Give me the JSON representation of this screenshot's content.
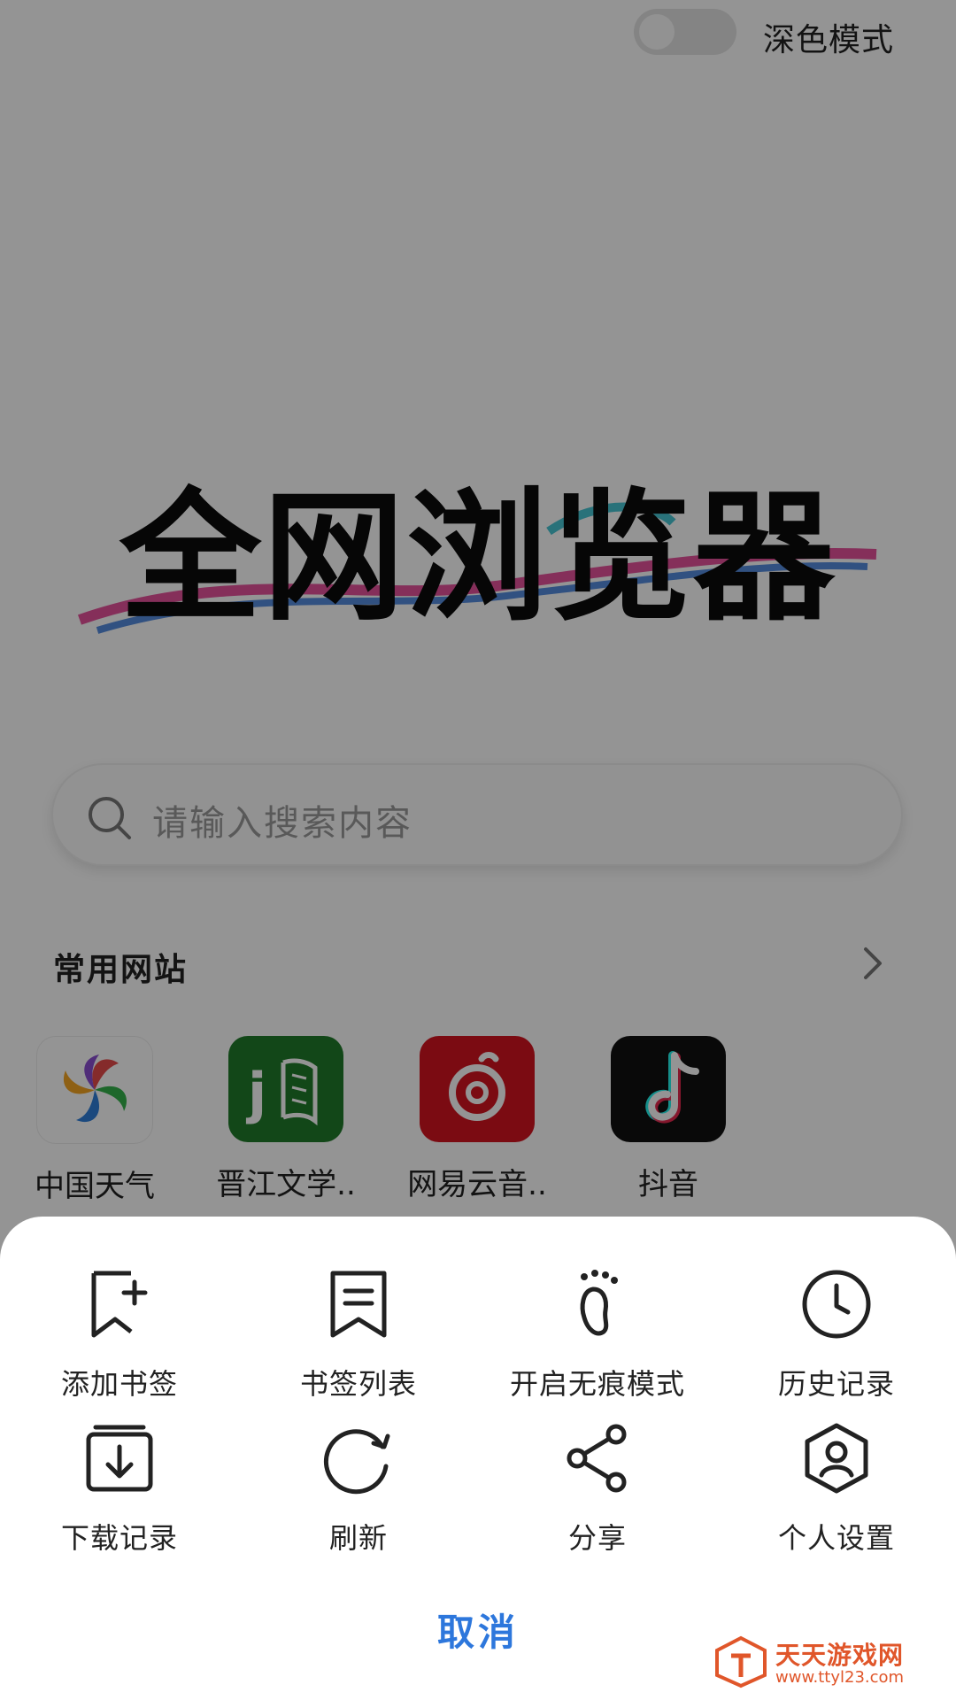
{
  "header": {
    "dark_mode_label": "深色模式",
    "dark_mode_on": false
  },
  "logo": {
    "text": "全网浏览器"
  },
  "search": {
    "placeholder": "请输入搜索内容"
  },
  "sites": {
    "title": "常用网站",
    "items": [
      {
        "label": "中国天气",
        "icon": "china-weather-icon",
        "color": "#ffffff"
      },
      {
        "label": "晋江文学..",
        "icon": "jinjiang-literature-icon",
        "color": "#1f7a2a"
      },
      {
        "label": "网易云音..",
        "icon": "netease-music-icon",
        "color": "#d5131f"
      },
      {
        "label": "抖音",
        "icon": "douyin-icon",
        "color": "#111111"
      }
    ]
  },
  "menu": {
    "items": [
      {
        "label": "添加书签",
        "icon": "add-bookmark-icon"
      },
      {
        "label": "书签列表",
        "icon": "bookmark-list-icon"
      },
      {
        "label": "开启无痕模式",
        "icon": "footprint-icon"
      },
      {
        "label": "历史记录",
        "icon": "clock-icon"
      },
      {
        "label": "下载记录",
        "icon": "download-icon"
      },
      {
        "label": "刷新",
        "icon": "refresh-icon"
      },
      {
        "label": "分享",
        "icon": "share-icon"
      },
      {
        "label": "个人设置",
        "icon": "user-settings-icon"
      }
    ],
    "cancel_label": "取消"
  },
  "watermark": {
    "text": "天天游戏网",
    "url": "www.ttyl23.com"
  },
  "colors": {
    "accent": "#2d77dc",
    "watermark": "#e0562a"
  }
}
